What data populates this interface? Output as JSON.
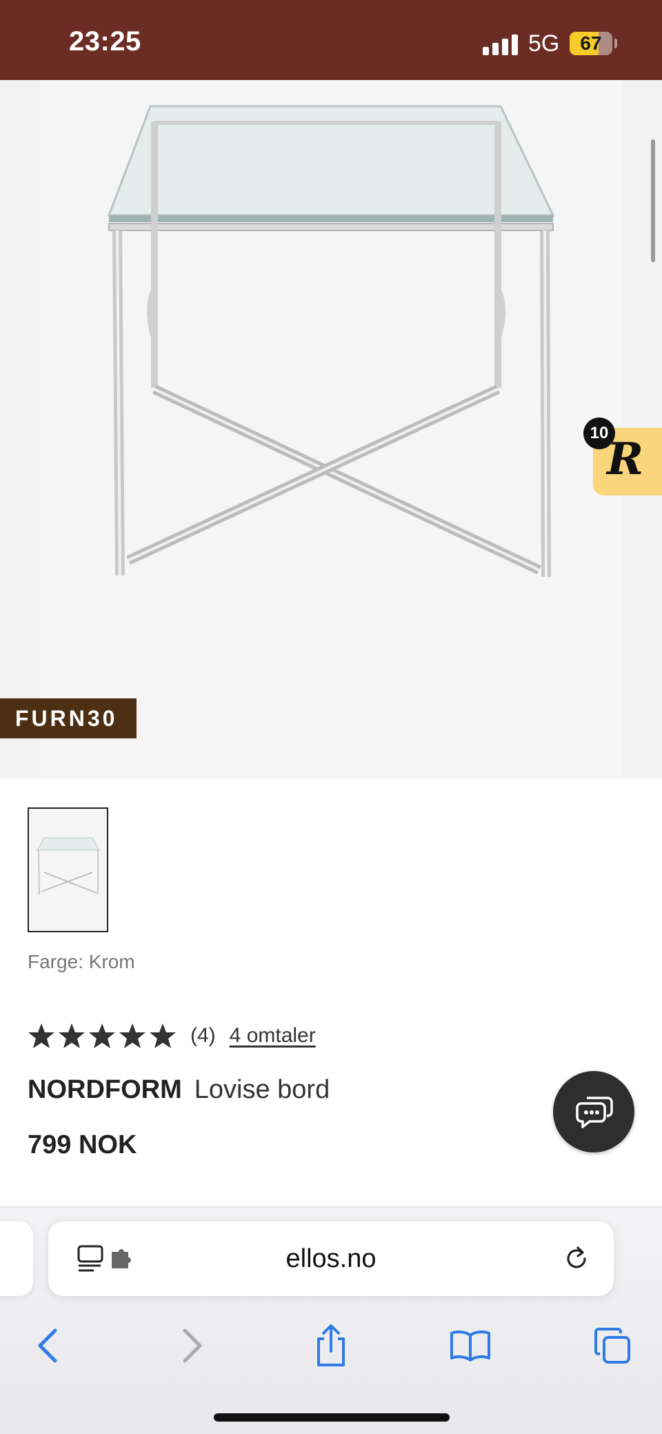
{
  "status_bar": {
    "time": "23:25",
    "network": "5G",
    "battery_percent": 67,
    "battery_label": "67"
  },
  "hero": {
    "image_alt": "Glass side table with chrome X-frame",
    "promo_code": "FURN30",
    "reward_badge": {
      "count": "10",
      "letter": "R"
    }
  },
  "product": {
    "color_label": "Farge: Krom",
    "rating_value": 5,
    "rating_count": "(4)",
    "reviews_link": "4 omtaler",
    "brand": "NORDFORM",
    "name": "Lovise bord",
    "price": "799 NOK"
  },
  "browser": {
    "url": "ellos.no",
    "toolbar": [
      "back-icon",
      "forward-icon",
      "share-icon",
      "bookmarks-icon",
      "tabs-icon"
    ],
    "accent_color": "#2f7ae5"
  }
}
